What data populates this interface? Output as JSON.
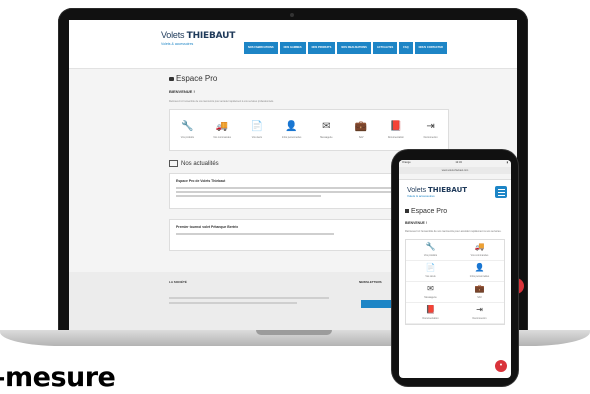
{
  "site": {
    "logo_main": "Volets",
    "logo_brand": "THIEBAUT",
    "logo_sub": "Volets & accessoires",
    "nav": [
      "NOS FABRICATIONS",
      "NOS GAMMES",
      "NOS PRODUITS",
      "NOS REALISATIONS",
      "ACTUALITES",
      "FAQ",
      "NOUS CONTACTER"
    ],
    "page_title": "Espace Pro",
    "greeting": "BIENVENUE !",
    "intro": "Retrouvez ici l'ensemble de vos raccourcis pour accéder rapidement à vos services professionnels.",
    "shortcuts": [
      {
        "label": "Vos produits",
        "icon": "wrench-icon",
        "glyph": "🔧"
      },
      {
        "label": "Vos commandes",
        "icon": "truck-icon",
        "glyph": "🚚"
      },
      {
        "label": "Vos devis",
        "icon": "document-icon",
        "glyph": "📄"
      },
      {
        "label": "Infos personnelles",
        "icon": "user-icon",
        "glyph": "👤"
      },
      {
        "label": "Messagerie",
        "icon": "mail-icon",
        "glyph": "✉"
      },
      {
        "label": "SAV",
        "icon": "briefcase-icon",
        "glyph": "💼"
      },
      {
        "label": "Documentation",
        "icon": "book-icon",
        "glyph": "📕"
      },
      {
        "label": "Déconnexion",
        "icon": "logout-icon",
        "glyph": "⇥"
      }
    ],
    "news_title": "Nos actualités",
    "news": [
      {
        "title": "Espace Pro de Volets Thiebaut"
      },
      {
        "title": "Premier tournoi volet Pétanque Bertrix"
      }
    ],
    "footer_left": "LA SOCIÉTÉ",
    "footer_right": "NEWSLETTERS",
    "headline": "–mesure"
  },
  "phone": {
    "status_left": "Orange",
    "status_center": "12:34",
    "url": "www.volets-thiebaut.com",
    "page_title": "Espace Pro",
    "greeting": "BIENVENUE !",
    "intro": "Retrouvez ici l'ensemble de vos raccourcis pour accéder rapidement à vos services.",
    "tiles": [
      {
        "label": "Vos produits",
        "icon": "wrench-icon",
        "glyph": "🔧"
      },
      {
        "label": "Vos commandes",
        "icon": "truck-icon",
        "glyph": "🚚"
      },
      {
        "label": "Vos devis",
        "icon": "document-icon",
        "glyph": "📄"
      },
      {
        "label": "Infos personnelles",
        "icon": "user-icon",
        "glyph": "👤"
      },
      {
        "label": "Messagerie",
        "icon": "mail-icon",
        "glyph": "✉"
      },
      {
        "label": "SAV",
        "icon": "briefcase-icon",
        "glyph": "💼"
      },
      {
        "label": "Documentation",
        "icon": "book-icon",
        "glyph": "📕"
      },
      {
        "label": "Déconnexion",
        "icon": "logout-icon",
        "glyph": "⇥"
      }
    ]
  },
  "colors": {
    "accent": "#1d85c6",
    "fab": "#d9333a",
    "navy": "#1f3a5a"
  }
}
